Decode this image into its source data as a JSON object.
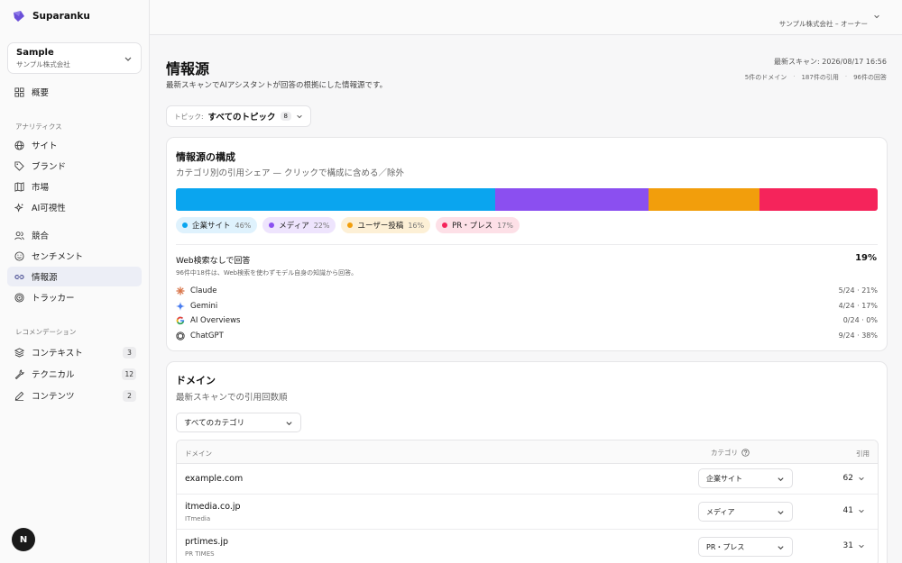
{
  "brand": {
    "name": "Suparanku"
  },
  "org": {
    "name": "Sample",
    "company": "サンプル株式会社"
  },
  "account": {
    "label": "サンプル株式会社 – オーナー"
  },
  "nav": {
    "overview": "概要",
    "analytics_section": "アナリティクス",
    "site": "サイト",
    "brand": "ブランド",
    "market": "市場",
    "ai_visibility": "AI可視性",
    "competitors": "競合",
    "sentiment": "センチメント",
    "sources": "情報源",
    "tracker": "トラッカー",
    "reco_section": "レコメンデーション",
    "context": "コンテキスト",
    "context_count": "3",
    "technical": "テクニカル",
    "technical_count": "12",
    "contents": "コンテンツ",
    "contents_count": "2"
  },
  "page": {
    "title": "情報源",
    "subtitle": "最新スキャンでAIアシスタントが回答の根拠にした情報源です。",
    "scan_date": "最新スキャン: 2026/08/17 16:56",
    "meta_domains": "5件のドメイン",
    "meta_citations": "187件の引用",
    "meta_answers": "96件の回答",
    "meta_sep": "·"
  },
  "topic_filter": {
    "label": "トピック:",
    "value": "すべてのトピック",
    "count": "8"
  },
  "composition": {
    "title": "情報源の構成",
    "subtitle": "カテゴリ別の引用シェア — クリックで構成に含める／除外",
    "segments": [
      {
        "name": "企業サイト",
        "pct": "46%",
        "value": 46,
        "color": "#0aa5ef",
        "chip_bg": "#dff2fd"
      },
      {
        "name": "メディア",
        "pct": "22%",
        "value": 22,
        "color": "#8b4ff0",
        "chip_bg": "#eee4fd"
      },
      {
        "name": "ユーザー投稿",
        "pct": "16%",
        "value": 16,
        "color": "#f29e0c",
        "chip_bg": "#fdf0d6"
      },
      {
        "name": "PR・プレス",
        "pct": "17%",
        "value": 17,
        "color": "#f5245b",
        "chip_bg": "#fde0e7"
      }
    ],
    "noweb_title": "Web検索なしで回答",
    "noweb_pct": "19%",
    "noweb_sub": "96件中18件は、Web検索を使わずモデル自身の知識から回答。",
    "models": [
      {
        "name": "Claude",
        "value": "5/24 · 21%"
      },
      {
        "name": "Gemini",
        "value": "4/24 · 17%"
      },
      {
        "name": "AI Overviews",
        "value": "0/24 · 0%"
      },
      {
        "name": "ChatGPT",
        "value": "9/24 · 38%"
      }
    ]
  },
  "domains": {
    "title": "ドメイン",
    "subtitle": "最新スキャンでの引用回数順",
    "category_filter": "すべてのカテゴリ",
    "col_domain": "ドメイン",
    "col_category": "カテゴリ",
    "col_citations": "引用",
    "rows": [
      {
        "domain": "example.com",
        "sub": "",
        "category": "企業サイト",
        "citations": "62"
      },
      {
        "domain": "itmedia.co.jp",
        "sub": "ITmedia",
        "category": "メディア",
        "citations": "41"
      },
      {
        "domain": "prtimes.jp",
        "sub": "PR TIMES",
        "category": "PR・プレス",
        "citations": "31"
      }
    ]
  },
  "badge": {
    "letter": "N"
  }
}
